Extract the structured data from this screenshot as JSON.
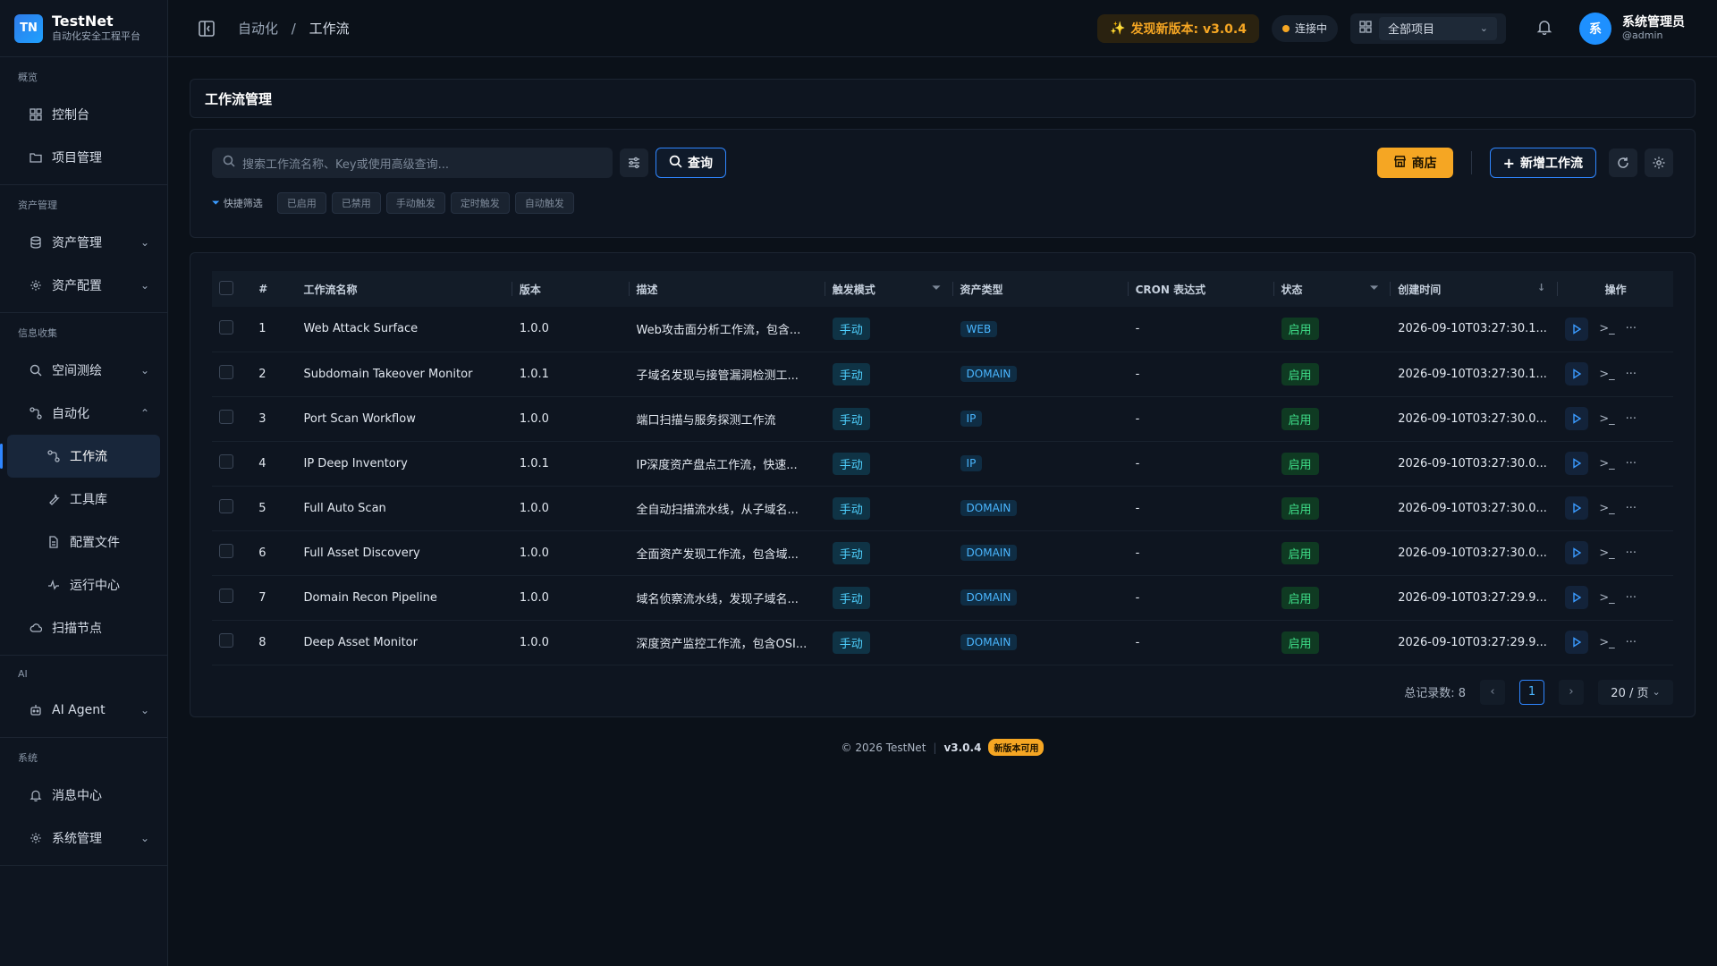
{
  "brand": {
    "logo": "TN",
    "name": "TestNet",
    "subtitle": "自动化安全工程平台"
  },
  "sidebar": {
    "sections": [
      {
        "title": "概览",
        "items": [
          {
            "label": "控制台",
            "icon": "dashboard-icon"
          },
          {
            "label": "项目管理",
            "icon": "folder-icon"
          }
        ]
      },
      {
        "title": "资产管理",
        "items": [
          {
            "label": "资产管理",
            "icon": "database-icon",
            "expand": true
          },
          {
            "label": "资产配置",
            "icon": "gear-icon",
            "expand": true
          }
        ]
      },
      {
        "title": "信息收集",
        "items": [
          {
            "label": "空间测绘",
            "icon": "search-icon",
            "expand": true
          },
          {
            "label": "自动化",
            "icon": "workflow-icon",
            "expanded": true
          },
          {
            "label": "工作流",
            "icon": "workflow-icon",
            "sub": true,
            "active": true
          },
          {
            "label": "工具库",
            "icon": "wrench-icon",
            "sub": true
          },
          {
            "label": "配置文件",
            "icon": "file-icon",
            "sub": true
          },
          {
            "label": "运行中心",
            "icon": "activity-icon",
            "sub": true
          },
          {
            "label": "扫描节点",
            "icon": "cloud-icon"
          }
        ]
      },
      {
        "title": "AI",
        "items": [
          {
            "label": "AI Agent",
            "icon": "robot-icon",
            "expand": true
          }
        ]
      },
      {
        "title": "系统",
        "items": [
          {
            "label": "消息中心",
            "icon": "bell-icon"
          },
          {
            "label": "系统管理",
            "icon": "gear-icon",
            "expand": true
          }
        ]
      }
    ]
  },
  "topbar": {
    "breadcrumb": [
      "自动化",
      "工作流"
    ],
    "update": "发现新版本: v3.0.4",
    "connection": "连接中",
    "project": "全部项目",
    "user_name": "系统管理员",
    "user_handle": "@admin",
    "avatar": "系"
  },
  "page": {
    "title": "工作流管理",
    "search_placeholder": "搜索工作流名称、Key或使用高级查询...",
    "query_label": "查询",
    "store_label": "商店",
    "add_label": "新增工作流",
    "filter_label": "快捷筛选",
    "filters": [
      "已启用",
      "已禁用",
      "手动触发",
      "定时触发",
      "自动触发"
    ]
  },
  "table": {
    "headers": [
      "#",
      "工作流名称",
      "版本",
      "描述",
      "触发模式",
      "资产类型",
      "CRON 表达式",
      "状态",
      "创建时间",
      "操作"
    ],
    "rows": [
      {
        "n": "1",
        "name": "Web Attack Surface",
        "ver": "1.0.0",
        "desc": "Web攻击面分析工作流，包含...",
        "trigger": "手动",
        "asset": "WEB",
        "cron": "-",
        "status": "启用",
        "created": "2026-09-10T03:27:30.1..."
      },
      {
        "n": "2",
        "name": "Subdomain Takeover Monitor",
        "ver": "1.0.1",
        "desc": "子域名发现与接管漏洞检测工...",
        "trigger": "手动",
        "asset": "DOMAIN",
        "cron": "-",
        "status": "启用",
        "created": "2026-09-10T03:27:30.1..."
      },
      {
        "n": "3",
        "name": "Port Scan Workflow",
        "ver": "1.0.0",
        "desc": "端口扫描与服务探测工作流",
        "trigger": "手动",
        "asset": "IP",
        "cron": "-",
        "status": "启用",
        "created": "2026-09-10T03:27:30.0..."
      },
      {
        "n": "4",
        "name": "IP Deep Inventory",
        "ver": "1.0.1",
        "desc": "IP深度资产盘点工作流，快速...",
        "trigger": "手动",
        "asset": "IP",
        "cron": "-",
        "status": "启用",
        "created": "2026-09-10T03:27:30.0..."
      },
      {
        "n": "5",
        "name": "Full Auto Scan",
        "ver": "1.0.0",
        "desc": "全自动扫描流水线，从子域名...",
        "trigger": "手动",
        "asset": "DOMAIN",
        "cron": "-",
        "status": "启用",
        "created": "2026-09-10T03:27:30.0..."
      },
      {
        "n": "6",
        "name": "Full Asset Discovery",
        "ver": "1.0.0",
        "desc": "全面资产发现工作流，包含域...",
        "trigger": "手动",
        "asset": "DOMAIN",
        "cron": "-",
        "status": "启用",
        "created": "2026-09-10T03:27:30.0..."
      },
      {
        "n": "7",
        "name": "Domain Recon Pipeline",
        "ver": "1.0.0",
        "desc": "域名侦察流水线，发现子域名...",
        "trigger": "手动",
        "asset": "DOMAIN",
        "cron": "-",
        "status": "启用",
        "created": "2026-09-10T03:27:29.9..."
      },
      {
        "n": "8",
        "name": "Deep Asset Monitor",
        "ver": "1.0.0",
        "desc": "深度资产监控工作流，包含OSI...",
        "trigger": "手动",
        "asset": "DOMAIN",
        "cron": "-",
        "status": "启用",
        "created": "2026-09-10T03:27:29.9..."
      }
    ]
  },
  "pager": {
    "total": "总记录数: 8",
    "current": "1",
    "size": "20 / 页"
  },
  "footer": {
    "copyright": "© 2026 TestNet",
    "version": "v3.0.4",
    "badge": "新版本可用"
  },
  "colors": {
    "accent": "#2f86ff",
    "warning": "#f5a623",
    "success": "#3fe08a",
    "bg": "#0b1119"
  }
}
